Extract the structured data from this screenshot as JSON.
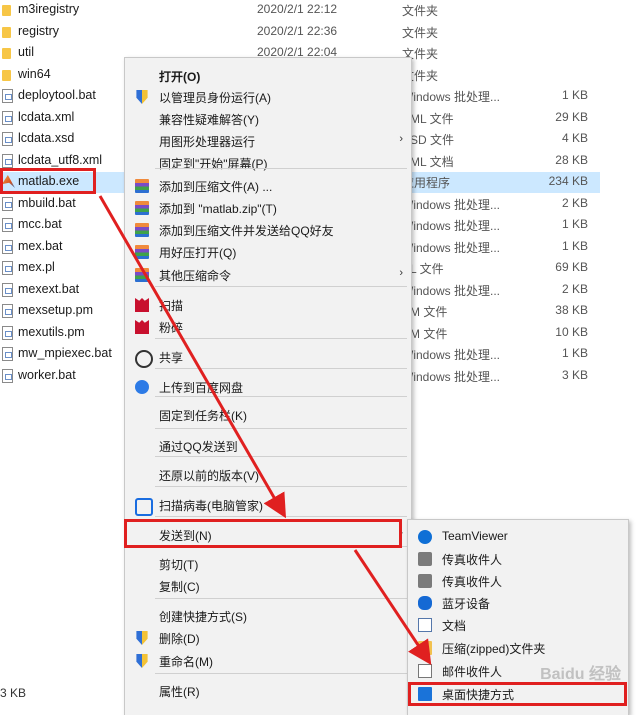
{
  "files": [
    {
      "name": "m3iregistry",
      "date": "2020/2/1 22:12",
      "type": "文件夹",
      "size": "",
      "icon": "folder-icon"
    },
    {
      "name": "registry",
      "date": "2020/2/1 22:36",
      "type": "文件夹",
      "size": "",
      "icon": "folder-icon"
    },
    {
      "name": "util",
      "date": "2020/2/1 22:04",
      "type": "文件夹",
      "size": "",
      "icon": "folder-icon"
    },
    {
      "name": "win64",
      "date": "",
      "type": "文件夹",
      "size": "",
      "icon": "folder-icon"
    },
    {
      "name": "deploytool.bat",
      "date": "",
      "type": "Windows 批处理...",
      "size": "1 KB",
      "icon": "batch-file-icon"
    },
    {
      "name": "lcdata.xml",
      "date": "",
      "type": "XML 文件",
      "size": "29 KB",
      "icon": "xml-file-icon"
    },
    {
      "name": "lcdata.xsd",
      "date": "",
      "type": "XSD 文件",
      "size": "4 KB",
      "icon": "xsd-file-icon"
    },
    {
      "name": "lcdata_utf8.xml",
      "date": "",
      "type": "XML 文档",
      "size": "28 KB",
      "icon": "xml-file-icon"
    },
    {
      "name": "matlab.exe",
      "date": "",
      "type": "应用程序",
      "size": "234 KB",
      "icon": "matlab-icon"
    },
    {
      "name": "mbuild.bat",
      "date": "",
      "type": "Windows 批处理...",
      "size": "2 KB",
      "icon": "batch-file-icon"
    },
    {
      "name": "mcc.bat",
      "date": "",
      "type": "Windows 批处理...",
      "size": "1 KB",
      "icon": "batch-file-icon"
    },
    {
      "name": "mex.bat",
      "date": "",
      "type": "Windows 批处理...",
      "size": "1 KB",
      "icon": "batch-file-icon"
    },
    {
      "name": "mex.pl",
      "date": "",
      "type": "PL 文件",
      "size": "69 KB",
      "icon": "pl-file-icon"
    },
    {
      "name": "mexext.bat",
      "date": "",
      "type": "Windows 批处理...",
      "size": "2 KB",
      "icon": "batch-file-icon"
    },
    {
      "name": "mexsetup.pm",
      "date": "",
      "type": "PM 文件",
      "size": "38 KB",
      "icon": "pm-file-icon"
    },
    {
      "name": "mexutils.pm",
      "date": "",
      "type": "PM 文件",
      "size": "10 KB",
      "icon": "pm-file-icon"
    },
    {
      "name": "mw_mpiexec.bat",
      "date": "",
      "type": "Windows 批处理...",
      "size": "1 KB",
      "icon": "batch-file-icon"
    },
    {
      "name": "worker.bat",
      "date": "",
      "type": "Windows 批处理...",
      "size": "3 KB",
      "icon": "batch-file-icon"
    }
  ],
  "status_bar": {
    "text": "3 KB"
  },
  "context_menu": {
    "items": [
      {
        "label": "打开(O)",
        "icon": "",
        "bold": true
      },
      {
        "label": "以管理员身份运行(A)",
        "icon": "uac-shield-icon"
      },
      {
        "label": "兼容性疑难解答(Y)",
        "icon": ""
      },
      {
        "label": "用图形处理器运行",
        "icon": "",
        "submenu": true
      },
      {
        "label": "固定到\"开始\"屏幕(P)",
        "icon": ""
      },
      {
        "label": "添加到压缩文件(A) ...",
        "icon": "winrar-icon"
      },
      {
        "label": "添加到 \"matlab.zip\"(T)",
        "icon": "winrar-icon"
      },
      {
        "label": "添加到压缩文件并发送给QQ好友",
        "icon": "winrar-icon"
      },
      {
        "label": "用好压打开(Q)",
        "icon": "winrar-icon"
      },
      {
        "label": "其他压缩命令",
        "icon": "winrar-icon",
        "submenu": true
      },
      {
        "label": "扫描",
        "icon": "mcafee-icon"
      },
      {
        "label": "粉碎",
        "icon": "mcafee-icon"
      },
      {
        "label": "共享",
        "icon": "share-icon"
      },
      {
        "label": "上传到百度网盘",
        "icon": "baidu-cloud-icon"
      },
      {
        "label": "固定到任务栏(K)",
        "icon": ""
      },
      {
        "label": "通过QQ发送到",
        "icon": ""
      },
      {
        "label": "还原以前的版本(V)",
        "icon": ""
      },
      {
        "label": "扫描病毒(电脑管家)",
        "icon": "qq-pc-manager-icon"
      },
      {
        "label": "发送到(N)",
        "icon": "",
        "submenu": true
      },
      {
        "label": "剪切(T)",
        "icon": ""
      },
      {
        "label": "复制(C)",
        "icon": ""
      },
      {
        "label": "创建快捷方式(S)",
        "icon": ""
      },
      {
        "label": "删除(D)",
        "icon": "uac-shield-icon"
      },
      {
        "label": "重命名(M)",
        "icon": "uac-shield-icon"
      },
      {
        "label": "属性(R)",
        "icon": ""
      }
    ]
  },
  "send_to_menu": {
    "items": [
      {
        "label": "TeamViewer",
        "icon": "teamviewer-icon"
      },
      {
        "label": "传真收件人",
        "icon": "fax-icon"
      },
      {
        "label": "传真收件人",
        "icon": "fax-icon"
      },
      {
        "label": "蓝牙设备",
        "icon": "bluetooth-icon"
      },
      {
        "label": "文档",
        "icon": "document-icon"
      },
      {
        "label": "压缩(zipped)文件夹",
        "icon": "zip-folder-icon"
      },
      {
        "label": "邮件收件人",
        "icon": "mail-icon"
      },
      {
        "label": "桌面快捷方式",
        "icon": "desktop-icon"
      }
    ]
  },
  "watermark": "Baidu 经验",
  "colors": {
    "highlight": "#e02020",
    "selection": "#cce8ff",
    "menu_bg": "#f2f2f2"
  }
}
